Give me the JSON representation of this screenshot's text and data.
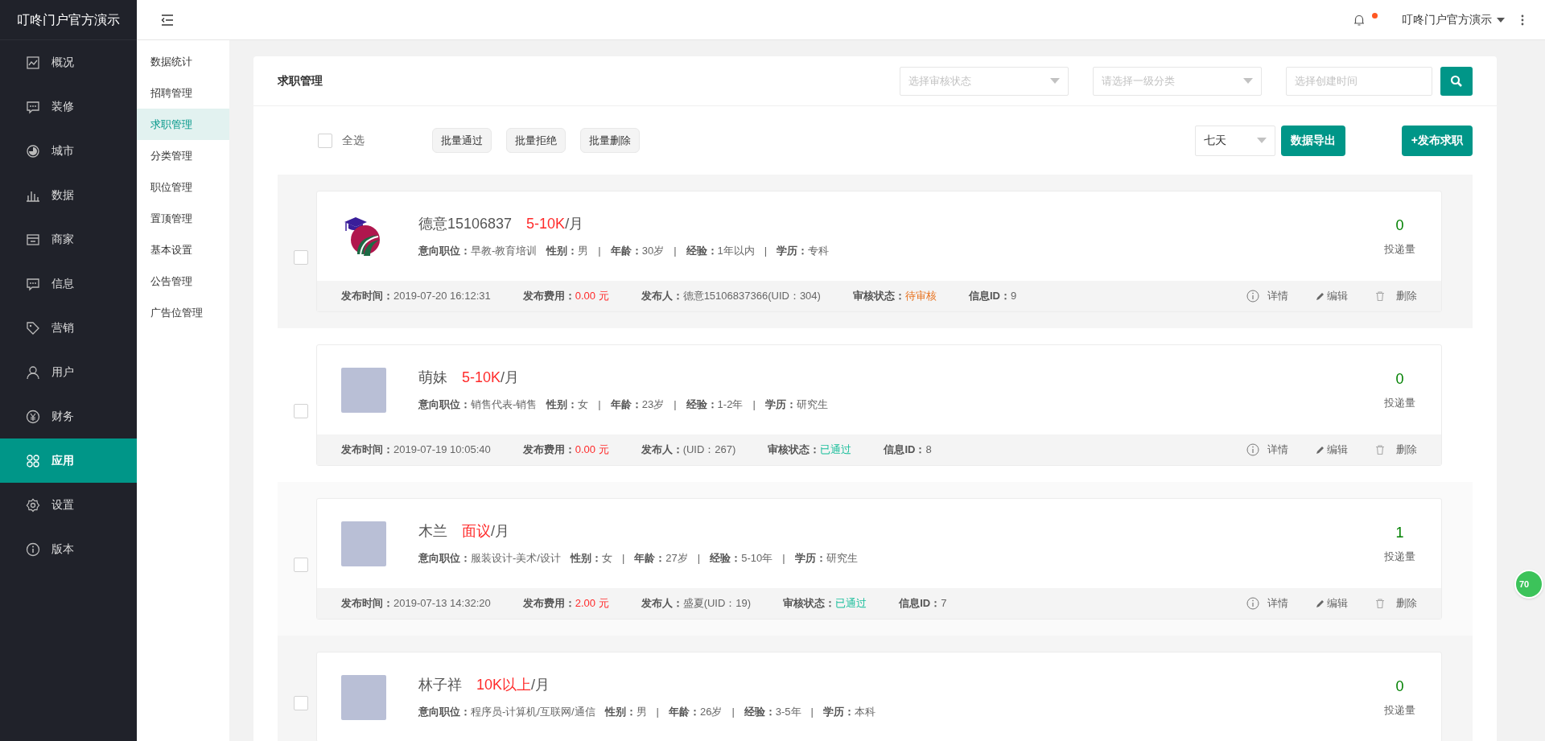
{
  "brand": "叮咚门户官方演示",
  "nav": [
    {
      "label": "概况",
      "selected": false
    },
    {
      "label": "装修",
      "selected": false
    },
    {
      "label": "城市",
      "selected": false
    },
    {
      "label": "数据",
      "selected": false
    },
    {
      "label": "商家",
      "selected": false
    },
    {
      "label": "信息",
      "selected": false
    },
    {
      "label": "营销",
      "selected": false
    },
    {
      "label": "用户",
      "selected": false
    },
    {
      "label": "财务",
      "selected": false
    },
    {
      "label": "应用",
      "selected": true
    },
    {
      "label": "设置",
      "selected": false
    },
    {
      "label": "版本",
      "selected": false
    }
  ],
  "subnav": [
    {
      "label": "数据统计",
      "selected": false
    },
    {
      "label": "招聘管理",
      "selected": false
    },
    {
      "label": "求职管理",
      "selected": true
    },
    {
      "label": "分类管理",
      "selected": false
    },
    {
      "label": "职位管理",
      "selected": false
    },
    {
      "label": "置顶管理",
      "selected": false
    },
    {
      "label": "基本设置",
      "selected": false
    },
    {
      "label": "公告管理",
      "selected": false
    },
    {
      "label": "广告位管理",
      "selected": false
    }
  ],
  "header": {
    "user": "叮咚门户官方演示",
    "notification_dot": true
  },
  "panel": {
    "title": "求职管理",
    "filters": [
      {
        "kind": "select",
        "placeholder": "选择审核状态"
      },
      {
        "kind": "select",
        "placeholder": "请选择一级分类"
      },
      {
        "kind": "input",
        "placeholder": "选择创建时间"
      }
    ],
    "select_all": {
      "label": "全选",
      "checked": false
    },
    "batch_buttons": [
      "批量通过",
      "批量拒绝",
      "批量删除"
    ],
    "period": "七天",
    "export_button": "数据导出",
    "publish_button": "+发布求职"
  },
  "entries": [
    {
      "kind": "logo",
      "checked": false,
      "name": "德意15106837",
      "salary": "5-10K",
      "unit": "/月",
      "fields": [
        {
          "label": "意向职位：",
          "value": "早教-教育培训"
        },
        {
          "label": "性别：",
          "value": "男"
        },
        {
          "divider": "|",
          "label": "年龄：",
          "value": "30岁"
        },
        {
          "divider": "|",
          "label": "经验：",
          "value": "1年以内"
        },
        {
          "divider": "|",
          "label": "学历：",
          "value": "专科"
        }
      ],
      "count": "0",
      "count_label": "投递量",
      "footer": {
        "time_label": "发布时间：",
        "time": "2019-07-20 16:12:31",
        "fee_label": "发布费用：",
        "fee": "0.00 元",
        "publisher_label": "发布人：",
        "publisher": "德意15106837366(UID：304)",
        "status_label": "审核状态：",
        "status": "待审核",
        "kind": "pending",
        "id_label": "信息ID：",
        "id": "9",
        "actions": [
          "详情",
          "编辑",
          "删除"
        ]
      }
    },
    {
      "kind": "photo",
      "checked": false,
      "name": "萌妹",
      "salary": "5-10K",
      "unit": "/月",
      "fields": [
        {
          "label": "意向职位：",
          "value": "销售代表-销售"
        },
        {
          "label": "性别：",
          "value": "女"
        },
        {
          "divider": "|",
          "label": "年龄：",
          "value": "23岁"
        },
        {
          "divider": "|",
          "label": "经验：",
          "value": "1-2年"
        },
        {
          "divider": "|",
          "label": "学历：",
          "value": "研究生"
        }
      ],
      "count": "0",
      "count_label": "投递量",
      "footer": {
        "time_label": "发布时间：",
        "time": "2019-07-19 10:05:40",
        "fee_label": "发布费用：",
        "fee": "0.00 元",
        "publisher_label": "发布人：",
        "publisher": "(UID：267)",
        "status_label": "审核状态：",
        "status": "已通过",
        "kind": "approved",
        "id_label": "信息ID：",
        "id": "8",
        "actions": [
          "详情",
          "编辑",
          "删除"
        ]
      }
    },
    {
      "kind": "photo",
      "checked": false,
      "name": "木兰",
      "salary": "面议",
      "unit": "/月",
      "fields": [
        {
          "label": "意向职位：",
          "value": "服装设计-美术/设计"
        },
        {
          "label": "性别：",
          "value": "女"
        },
        {
          "divider": "|",
          "label": "年龄：",
          "value": "27岁"
        },
        {
          "divider": "|",
          "label": "经验：",
          "value": "5-10年"
        },
        {
          "divider": "|",
          "label": "学历：",
          "value": "研究生"
        }
      ],
      "count": "1",
      "count_label": "投递量",
      "footer": {
        "time_label": "发布时间：",
        "time": "2019-07-13 14:32:20",
        "fee_label": "发布费用：",
        "fee": "2.00 元",
        "publisher_label": "发布人：",
        "publisher": "盛夏(UID：19)",
        "status_label": "审核状态：",
        "status": "已通过",
        "kind": "approved",
        "id_label": "信息ID：",
        "id": "7",
        "actions": [
          "详情",
          "编辑",
          "删除"
        ]
      }
    },
    {
      "kind": "photo",
      "checked": false,
      "name": "林子祥",
      "salary": "10K以上",
      "unit": "/月",
      "fields": [
        {
          "label": "意向职位：",
          "value": "程序员-计算机/互联网/通信"
        },
        {
          "label": "性别：",
          "value": "男"
        },
        {
          "divider": "|",
          "label": "年龄：",
          "value": "26岁"
        },
        {
          "divider": "|",
          "label": "经验：",
          "value": "3-5年"
        },
        {
          "divider": "|",
          "label": "学历：",
          "value": "本科"
        }
      ],
      "count": "0",
      "count_label": "投递量"
    }
  ],
  "float_badge": "70"
}
